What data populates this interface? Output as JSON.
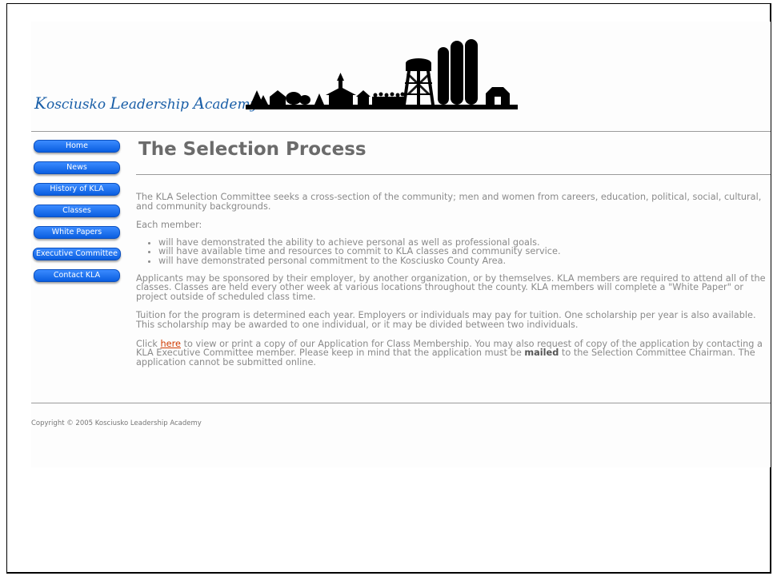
{
  "site": {
    "name_parts": [
      "K",
      "osciusko ",
      "L",
      "eadership ",
      "A",
      "cademy"
    ]
  },
  "nav": {
    "items": [
      "Home",
      "News",
      "History of KLA",
      "Classes",
      "White Papers",
      "Executive Committee",
      "Contact KLA"
    ]
  },
  "main": {
    "title": "The Selection Process",
    "p1": "The KLA Selection Committee seeks a cross-section of the community; men and women from careers, education, political, social, cultural, and community backgrounds.",
    "p2": "Each member:",
    "bullets": [
      "will have demonstrated the ability to achieve personal as well as professional goals.",
      "will have available time and resources to commit to KLA classes and community service.",
      "will have demonstrated personal commitment to the Kosciusko County Area."
    ],
    "p3": "Applicants may be sponsored by their employer, by another organization, or by themselves.  KLA members are required to attend all of the classes.  Classes are held every other week at various locations throughout the county.  KLA members will complete a \"White Paper\" or project outside of scheduled class time.",
    "p4": "Tuition for the program is determined each year.  Employers or individuals may pay for tuition.  One scholarship per year is also available.  This scholarship may be awarded to one individual, or it may be divided between two individuals.",
    "p5_pre": "Click ",
    "p5_link": "here",
    "p5_mid": " to view or print a copy of our Application for Class Membership.  You may also request of copy of the application by contacting a KLA Executive Committee member.  Please keep in mind that the application must be ",
    "p5_bold": "mailed",
    "p5_post": " to the Selection Committee Chairman.  The application cannot be submitted online."
  },
  "footer": {
    "copyright": "Copyright © 2005 Kosciusko Leadership Academy"
  },
  "colors": {
    "logo_blue": "#1a5fa8",
    "nav_blue": "#0a5ee0",
    "link": "#d03a00"
  }
}
